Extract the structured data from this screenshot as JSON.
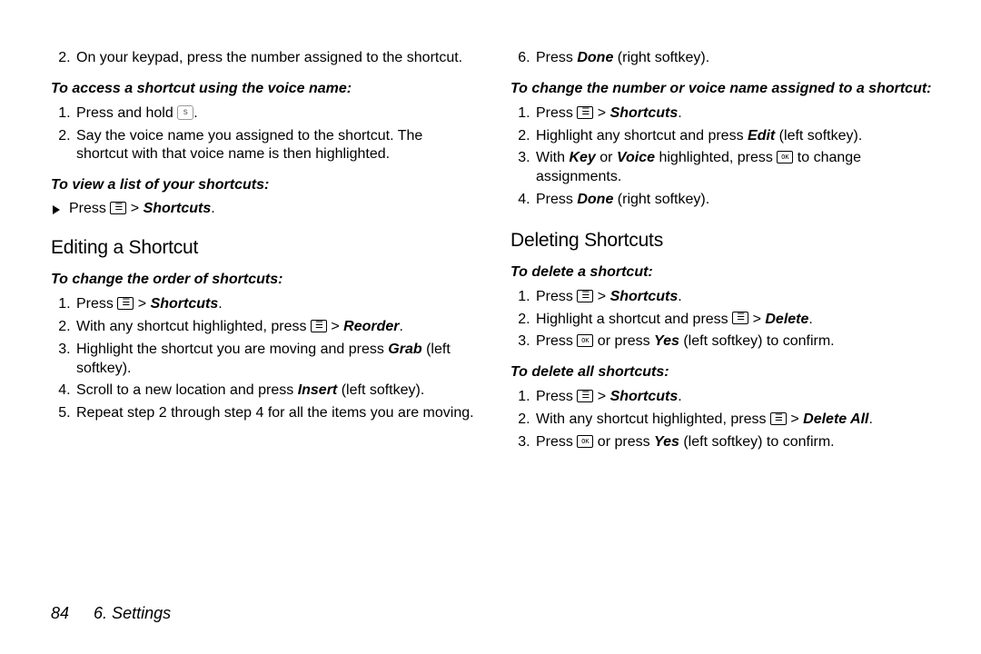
{
  "left": {
    "step2": "On your keypad, press the number assigned to the shortcut.",
    "sub_voice": "To access a shortcut using the voice name:",
    "voice1_a": "Press and hold ",
    "voice1_b": ".",
    "voice2": "Say the voice name you assigned to the shortcut. The shortcut with that voice name is then highlighted.",
    "sub_list": "To view a list of your shortcuts:",
    "list_press": "Press ",
    "list_gt": " > ",
    "list_shortcuts": "Shortcuts",
    "list_end": ".",
    "heading_edit": "Editing a Shortcut",
    "sub_order": "To change the order of shortcuts:",
    "o1_a": "Press ",
    "o1_b": " > ",
    "o1_c": "Shortcuts",
    "o1_d": ".",
    "o2_a": "With any shortcut highlighted, press ",
    "o2_b": " > ",
    "o2_c": "Reorder",
    "o2_d": ".",
    "o3_a": "Highlight the shortcut you are moving and press ",
    "o3_b": "Grab",
    "o3_c": " (left softkey).",
    "o4_a": "Scroll to a new location and press ",
    "o4_b": "Insert",
    "o4_c": " (left softkey).",
    "o5": "Repeat step 2 through step 4 for all the items you are moving."
  },
  "right": {
    "r6_a": "Press ",
    "r6_b": "Done",
    "r6_c": " (right softkey).",
    "sub_change": "To change the number or voice name assigned to a shortcut:",
    "c1_a": "Press ",
    "c1_b": " > ",
    "c1_c": "Shortcuts",
    "c1_d": ".",
    "c2_a": "Highlight any shortcut and press ",
    "c2_b": "Edit",
    "c2_c": " (left softkey).",
    "c3_a": "With ",
    "c3_b": "Key",
    "c3_c": " or ",
    "c3_d": "Voice",
    "c3_e": " highlighted, press ",
    "c3_f": " to change assignments.",
    "c4_a": "Press ",
    "c4_b": "Done",
    "c4_c": " (right softkey).",
    "heading_del": "Deleting Shortcuts",
    "sub_del": "To delete a shortcut:",
    "d1_a": "Press ",
    "d1_b": " > ",
    "d1_c": "Shortcuts",
    "d1_d": ".",
    "d2_a": "Highlight a shortcut and press ",
    "d2_b": " > ",
    "d2_c": "Delete",
    "d2_d": ".",
    "d3_a": "Press ",
    "d3_b": " or press ",
    "d3_c": "Yes",
    "d3_d": " (left softkey) to confirm.",
    "sub_delall": "To delete all shortcuts:",
    "da1_a": "Press ",
    "da1_b": " > ",
    "da1_c": "Shortcuts",
    "da1_d": ".",
    "da2_a": "With any shortcut highlighted, press ",
    "da2_b": " > ",
    "da2_c": "Delete All",
    "da2_d": ".",
    "da3_a": "Press ",
    "da3_b": " or press ",
    "da3_c": "Yes",
    "da3_d": " (left softkey) to confirm."
  },
  "footer": {
    "page": "84",
    "chapter": "6. Settings"
  },
  "icons": {
    "speak": "s"
  }
}
